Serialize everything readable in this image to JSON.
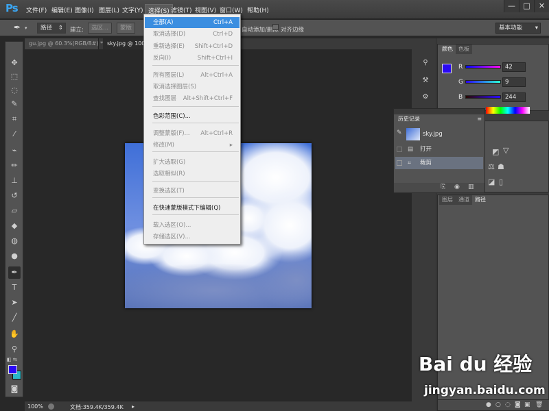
{
  "app": {
    "logo": "Ps"
  },
  "menubar": {
    "items": [
      "文件(F)",
      "编辑(E)",
      "图像(I)",
      "图层(L)",
      "文字(Y)",
      "选择(S)",
      "滤镜(T)",
      "视图(V)",
      "窗口(W)",
      "帮助(H)"
    ],
    "window_controls": [
      "—",
      "□",
      "✕"
    ]
  },
  "options": {
    "mode": "路径",
    "build_label": "建立:",
    "selection_btn": "选区...",
    "mask_btn": "蒙版",
    "add_remove": "自动添加/删除",
    "align_edges": "对齐边缘",
    "workspace": "基本功能"
  },
  "tabs": [
    {
      "label": "gu.jpg @ 60.3%(RGB/8#) *"
    },
    {
      "label": "sky.jpg @ 100%"
    }
  ],
  "dropdown": {
    "items": [
      {
        "label": "全部(A)",
        "shortcut": "Ctrl+A",
        "state": "highlight"
      },
      {
        "label": "取消选择(D)",
        "shortcut": "Ctrl+D",
        "state": "disabled"
      },
      {
        "label": "重新选择(E)",
        "shortcut": "Shift+Ctrl+D",
        "state": "disabled"
      },
      {
        "label": "反向(I)",
        "shortcut": "Shift+Ctrl+I",
        "state": "disabled"
      },
      {
        "label": "所有图层(L)",
        "shortcut": "Alt+Ctrl+A",
        "state": "disabled"
      },
      {
        "label": "取消选择图层(S)",
        "shortcut": "",
        "state": "disabled"
      },
      {
        "label": "查找图层",
        "shortcut": "Alt+Shift+Ctrl+F",
        "state": "disabled"
      },
      {
        "label": "色彩范围(C)...",
        "shortcut": "",
        "state": "normal"
      },
      {
        "label": "调整蒙版(F)...",
        "shortcut": "Alt+Ctrl+R",
        "state": "disabled"
      },
      {
        "label": "修改(M)",
        "shortcut": "▸",
        "state": "disabled"
      },
      {
        "label": "扩大选取(G)",
        "shortcut": "",
        "state": "disabled"
      },
      {
        "label": "选取相似(R)",
        "shortcut": "",
        "state": "disabled"
      },
      {
        "label": "变换选区(T)",
        "shortcut": "",
        "state": "disabled"
      },
      {
        "label": "在快速蒙版模式下编辑(Q)",
        "shortcut": "",
        "state": "normal"
      },
      {
        "label": "载入选区(O)...",
        "shortcut": "",
        "state": "disabled"
      },
      {
        "label": "存储选区(V)...",
        "shortcut": "",
        "state": "disabled"
      }
    ]
  },
  "color_panel": {
    "tabs": [
      "颜色",
      "色板"
    ],
    "r_label": "R",
    "g_label": "G",
    "b_label": "B",
    "r": "42",
    "g": "9",
    "b": "244",
    "foreground": "#2a09f4",
    "background": "#2ab8c8"
  },
  "history": {
    "title": "历史记录",
    "snapshot": "sky.jpg",
    "steps": [
      "打开",
      "裁剪"
    ]
  },
  "layers": {
    "tabs": [
      "图层",
      "通道",
      "路径"
    ]
  },
  "status": {
    "zoom": "100%",
    "doc": "文档:359.4K/359.4K"
  },
  "watermark": {
    "brand": "Bai du 经验",
    "url": "jingyan.baidu.com"
  }
}
